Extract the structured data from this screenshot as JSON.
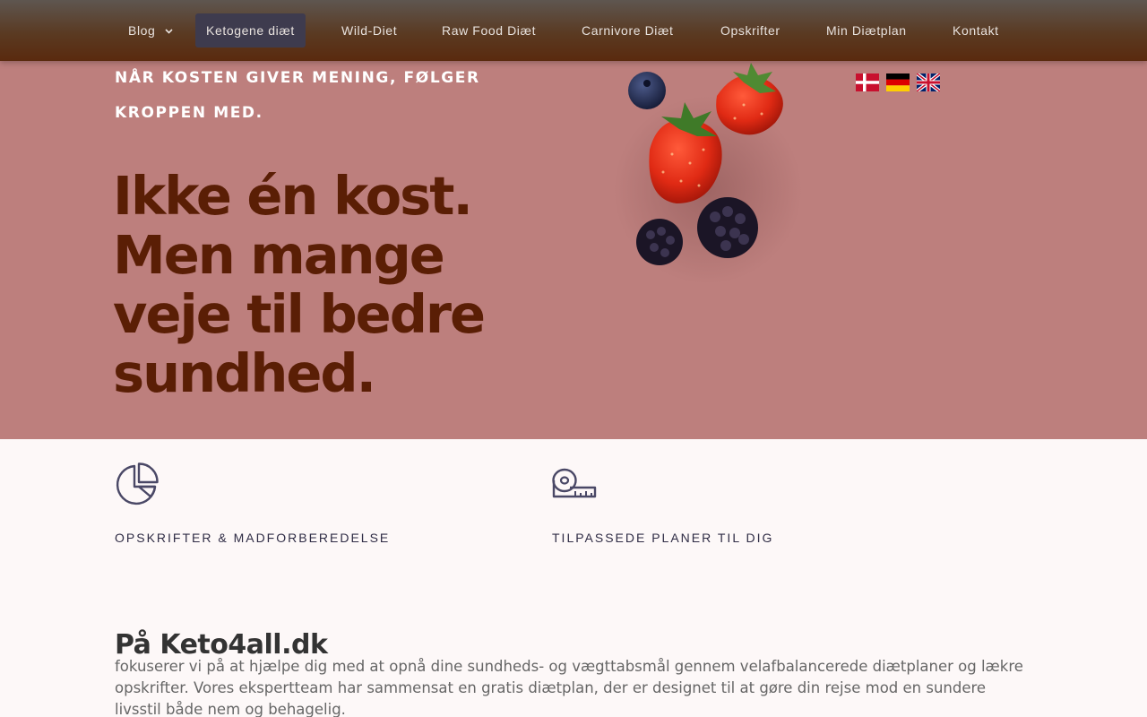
{
  "nav": {
    "items": [
      {
        "label": "Blog",
        "has_dropdown": true,
        "active": false
      },
      {
        "label": "Ketogene diæt",
        "active": true
      },
      {
        "label": "Wild-Diet",
        "active": false
      },
      {
        "label": "Raw Food Diæt",
        "active": false
      },
      {
        "label": "Carnivore Diæt",
        "active": false
      },
      {
        "label": "Opskrifter",
        "active": false
      },
      {
        "label": "Min Diætplan",
        "active": false
      },
      {
        "label": "Kontakt",
        "active": false
      }
    ]
  },
  "hero": {
    "tagline": "NÅR KOSTEN GIVER MENING, FØLGER KROPPEN MED.",
    "headline_lines": [
      "Ikke én kost.",
      "Men mange",
      "veje til bedre",
      "sundhed."
    ],
    "image": "berries-image",
    "background_color": "#bd7f7d",
    "headline_color": "#5a1e05"
  },
  "languages": [
    {
      "icon": "danish-flag-icon"
    },
    {
      "icon": "german-flag-icon"
    },
    {
      "icon": "uk-flag-icon"
    }
  ],
  "features": [
    {
      "icon": "pie-chart-icon",
      "title": "OPSKRIFTER & MADFORBEREDELSE"
    },
    {
      "icon": "measuring-tape-icon",
      "title": "TILPASSEDE PLANER TIL DIG"
    }
  ],
  "about": {
    "heading": "På Keto4all.dk",
    "text": "fokuserer vi på at hjælpe dig med at opnå dine sundheds- og vægttabsmål gennem velafbalancerede diætplaner og lækre opskrifter. Vores ekspertteam har sammensat en gratis diætplan, der er designet til at gøre din rejse mod en sundere livsstil både nem og behagelig."
  }
}
